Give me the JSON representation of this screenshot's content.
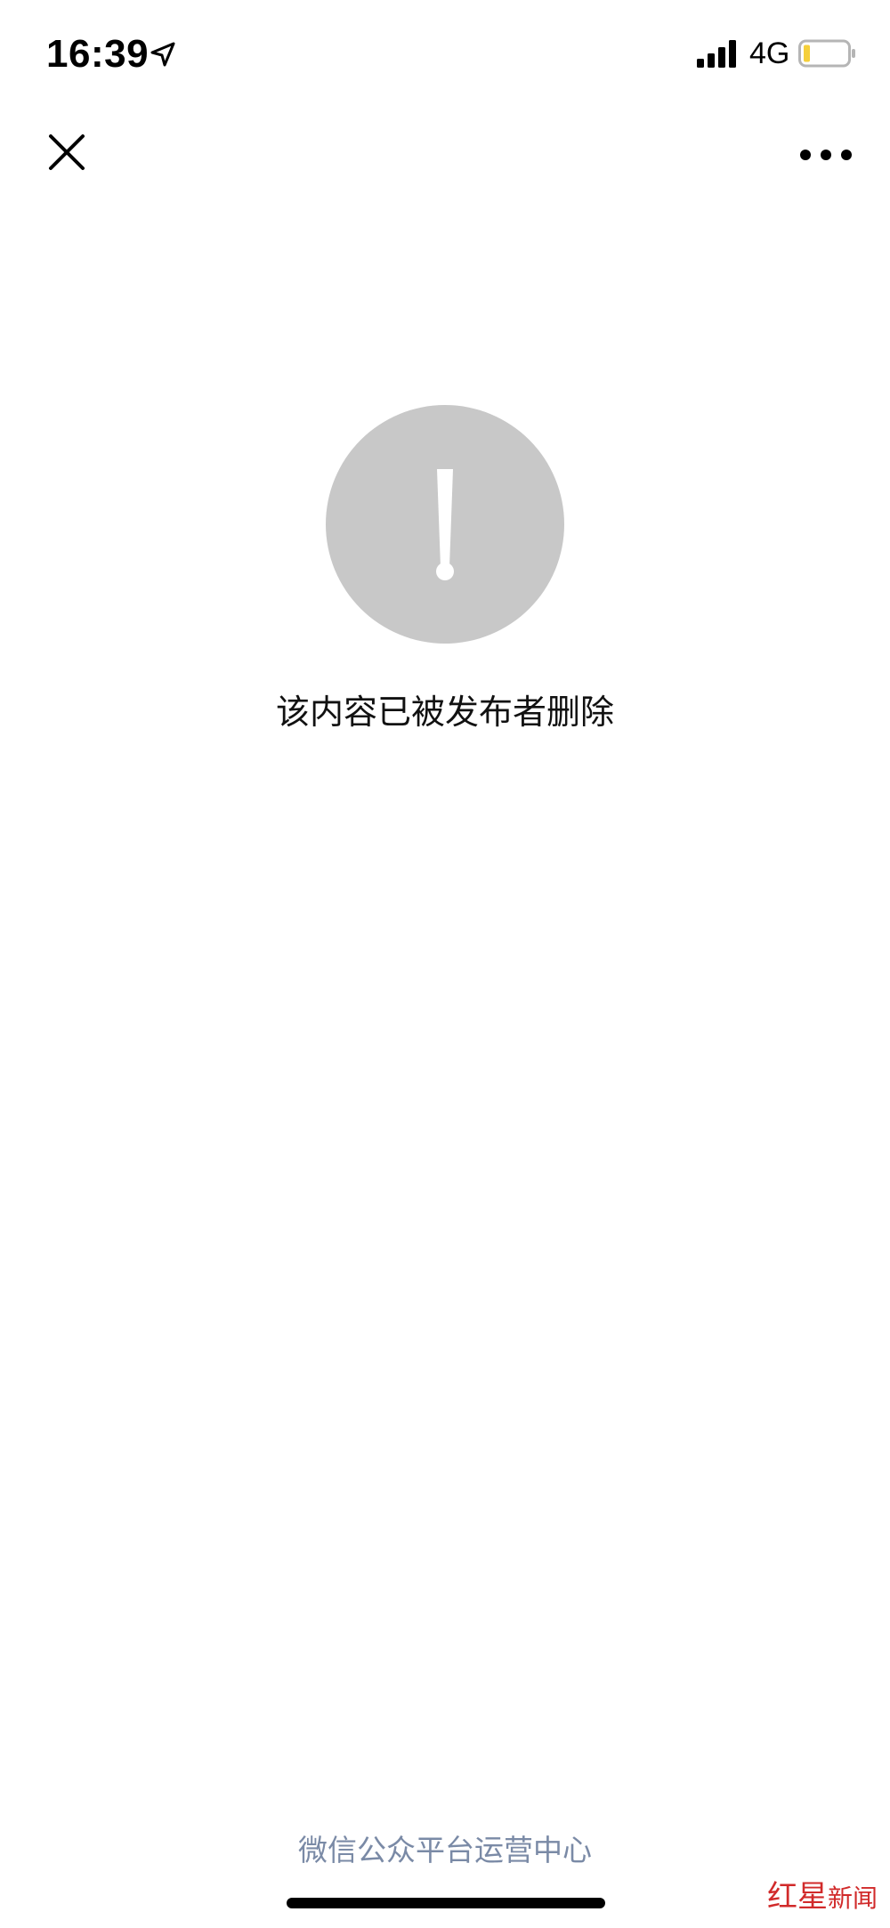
{
  "status_bar": {
    "time": "16:39",
    "network": "4G",
    "icons": [
      "location-arrow-icon",
      "cellular-signal-icon",
      "battery-low-icon"
    ],
    "battery_level_fraction": 0.1,
    "battery_color": "#f5cf3a"
  },
  "nav_bar": {
    "close_icon": "close-icon",
    "more_icon": "more-dots-icon"
  },
  "content": {
    "status_icon": "exclamation-icon",
    "circle_color": "#c8c8c8",
    "message": "该内容已被发布者删除"
  },
  "footer": {
    "link_label": "微信公众平台运营中心",
    "link_color": "#7a8aa6"
  },
  "watermark": {
    "text_main": "红星",
    "text_sub": "新闻",
    "color": "#d12a2a"
  }
}
